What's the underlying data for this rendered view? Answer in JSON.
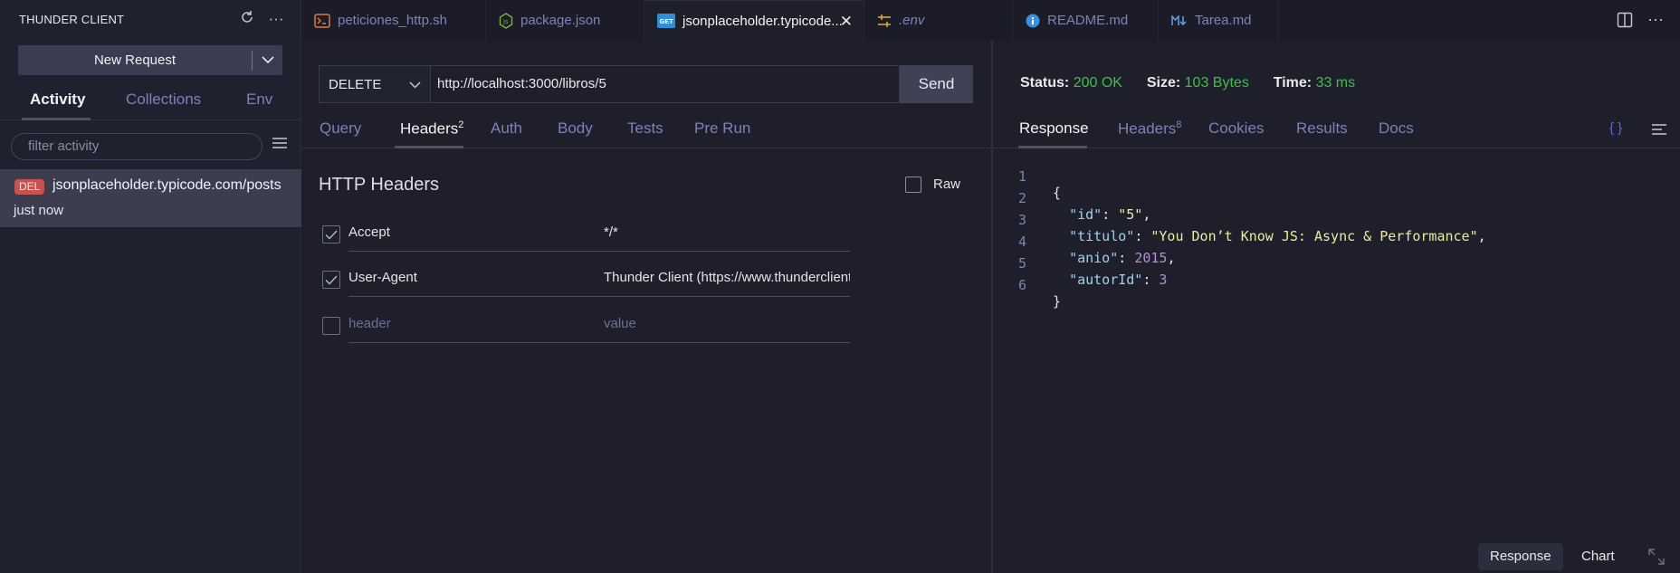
{
  "sidebar": {
    "title": "THUNDER CLIENT",
    "new_request_label": "New Request",
    "tabs": [
      {
        "label": "Activity",
        "active": true
      },
      {
        "label": "Collections",
        "active": false
      },
      {
        "label": "Env",
        "active": false
      }
    ],
    "filter_placeholder": "filter activity",
    "activity": [
      {
        "method_badge": "DEL",
        "url": "jsonplaceholder.typicode.com/posts",
        "time": "just now"
      }
    ]
  },
  "editor_tabs": [
    {
      "label": "peticiones_http.sh",
      "icon": "terminal-icon"
    },
    {
      "label": "package.json",
      "icon": "nodejs-icon"
    },
    {
      "label": "jsonplaceholder.typicode...",
      "icon": "get-badge-icon",
      "active": true
    },
    {
      "label": ".env",
      "icon": "settings-sliders-icon"
    },
    {
      "label": "README.md",
      "icon": "info-icon"
    },
    {
      "label": "Tarea.md",
      "icon": "markdown-icon"
    }
  ],
  "request": {
    "method": "DELETE",
    "url": "http://localhost:3000/libros/5",
    "send_label": "Send",
    "tabs": [
      {
        "label": "Query"
      },
      {
        "label": "Headers",
        "count": "2",
        "active": true
      },
      {
        "label": "Auth"
      },
      {
        "label": "Body"
      },
      {
        "label": "Tests"
      },
      {
        "label": "Pre Run"
      }
    ],
    "headers_title": "HTTP Headers",
    "raw_label": "Raw",
    "headers": [
      {
        "checked": true,
        "key": "Accept",
        "value": "*/*"
      },
      {
        "checked": true,
        "key": "User-Agent",
        "value": "Thunder Client (https://www.thunderclient.com)"
      }
    ],
    "new_header_placeholder": "header",
    "new_value_placeholder": "value"
  },
  "response": {
    "status_label": "Status:",
    "status_value": "200 OK",
    "size_label": "Size:",
    "size_value": "103 Bytes",
    "time_label": "Time:",
    "time_value": "33 ms",
    "tabs": [
      {
        "label": "Response",
        "active": true
      },
      {
        "label": "Headers",
        "count": "8"
      },
      {
        "label": "Cookies"
      },
      {
        "label": "Results"
      },
      {
        "label": "Docs"
      }
    ],
    "braces_label": "{ }",
    "body_lines": [
      "1",
      "2",
      "3",
      "4",
      "5",
      "6"
    ],
    "body": {
      "open": "{",
      "id_key": "\"id\"",
      "id_val": "\"5\"",
      "titulo_key": "\"titulo\"",
      "titulo_val": "\"You Don’t Know JS: Async & Performance\"",
      "anio_key": "\"anio\"",
      "anio_val": "2015",
      "autor_key": "\"autorId\"",
      "autor_val": "3",
      "close": "}"
    },
    "footer_response_label": "Response",
    "footer_chart_label": "Chart"
  },
  "colors": {
    "success": "#3fbf4a",
    "delete_badge": "#c8524f",
    "accent_blue": "#5b6bd6"
  }
}
